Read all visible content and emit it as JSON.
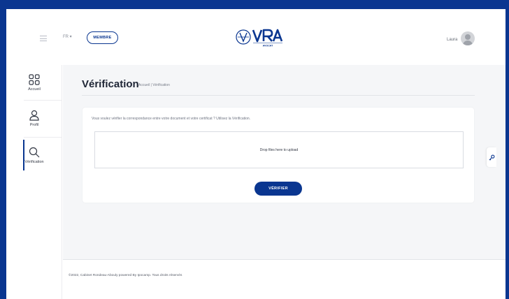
{
  "header": {
    "lang": "FR",
    "role_label": "MEMBRE",
    "logo_text": "VRA",
    "logo_tagline": "AVOCAT",
    "user_name": "Laura"
  },
  "sidebar": {
    "items": [
      {
        "label": "Accueil",
        "icon": "grid-icon",
        "active": false
      },
      {
        "label": "Profil",
        "icon": "user-icon",
        "active": false
      },
      {
        "label": "Vérification",
        "icon": "search-icon",
        "active": true
      }
    ]
  },
  "main": {
    "title": "Vérification",
    "breadcrumb": {
      "home": "Accueil",
      "separator": "|",
      "current": "Vérification"
    },
    "card_text": "Vous voulez vérifier la correspondance entre votre document et votre certificat ? Utilisez la Vérification.",
    "dropzone_text": "Drop files here to upload",
    "verify_button": "VÉRIFIER"
  },
  "footer": {
    "text": "©2022, Cabinet Rondeau-Abouly powered By Ipocamp. Tous droits réservés"
  },
  "colors": {
    "brand": "#0a3690",
    "background": "#f5f6f8"
  }
}
